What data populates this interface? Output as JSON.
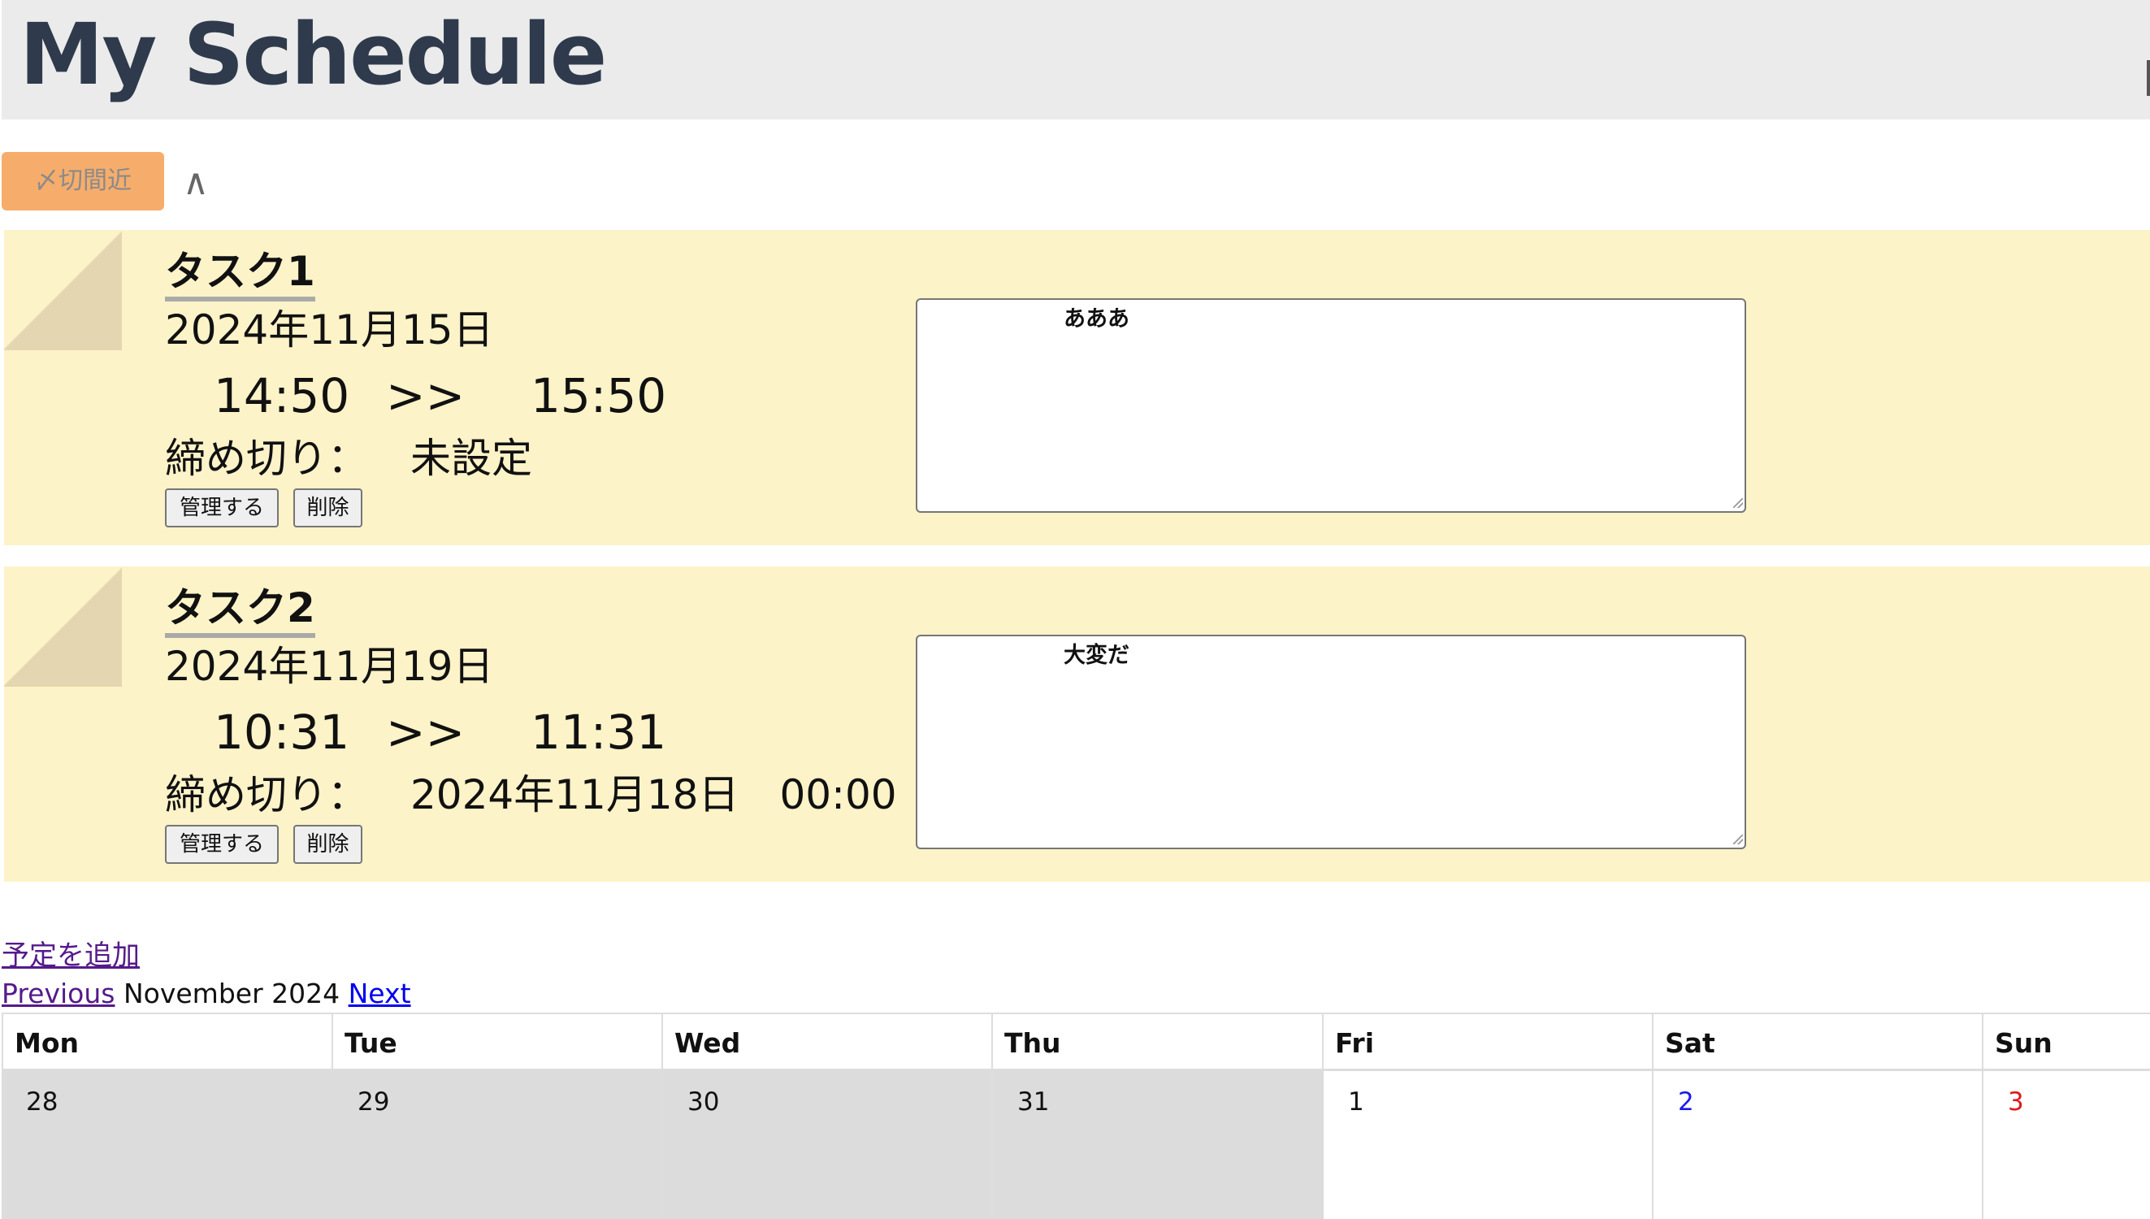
{
  "app": {
    "title": "My Schedule"
  },
  "filter": {
    "deadline_label": "〆切間近",
    "collapse_label": "∧"
  },
  "tasks": [
    {
      "title": "タスク1",
      "date": "2024年11月15日",
      "start": "14:50",
      "arrow": ">>",
      "end": "15:50",
      "deadline_label": "締め切り：",
      "deadline_value": "未設定",
      "manage_label": "管理する",
      "delete_label": "削除",
      "memo": "あああ"
    },
    {
      "title": "タスク2",
      "date": "2024年11月19日",
      "start": "10:31",
      "arrow": ">>",
      "end": "11:31",
      "deadline_label": "締め切り：",
      "deadline_value": "2024年11月18日　00:00",
      "manage_label": "管理する",
      "delete_label": "削除",
      "memo": "大変だ"
    }
  ],
  "links": {
    "add_schedule": "予定を追加"
  },
  "calendar": {
    "prev_label": "Previous",
    "month_label": "November 2024",
    "next_label": "Next",
    "weekdays": [
      "Mon",
      "Tue",
      "Wed",
      "Thu",
      "Fri",
      "Sat",
      "Sun"
    ],
    "first_row": [
      "28",
      "29",
      "30",
      "31",
      "1",
      "2",
      "3"
    ]
  },
  "colors": {
    "header_bg": "#ebebeb",
    "title_color": "#2f3b4c",
    "deadline_button": "#f6ad6b",
    "card_bg": "#fdf3c8",
    "other_month_bg": "#dcdcdc",
    "saturday": "#1a1aee",
    "sunday": "#e01818"
  }
}
